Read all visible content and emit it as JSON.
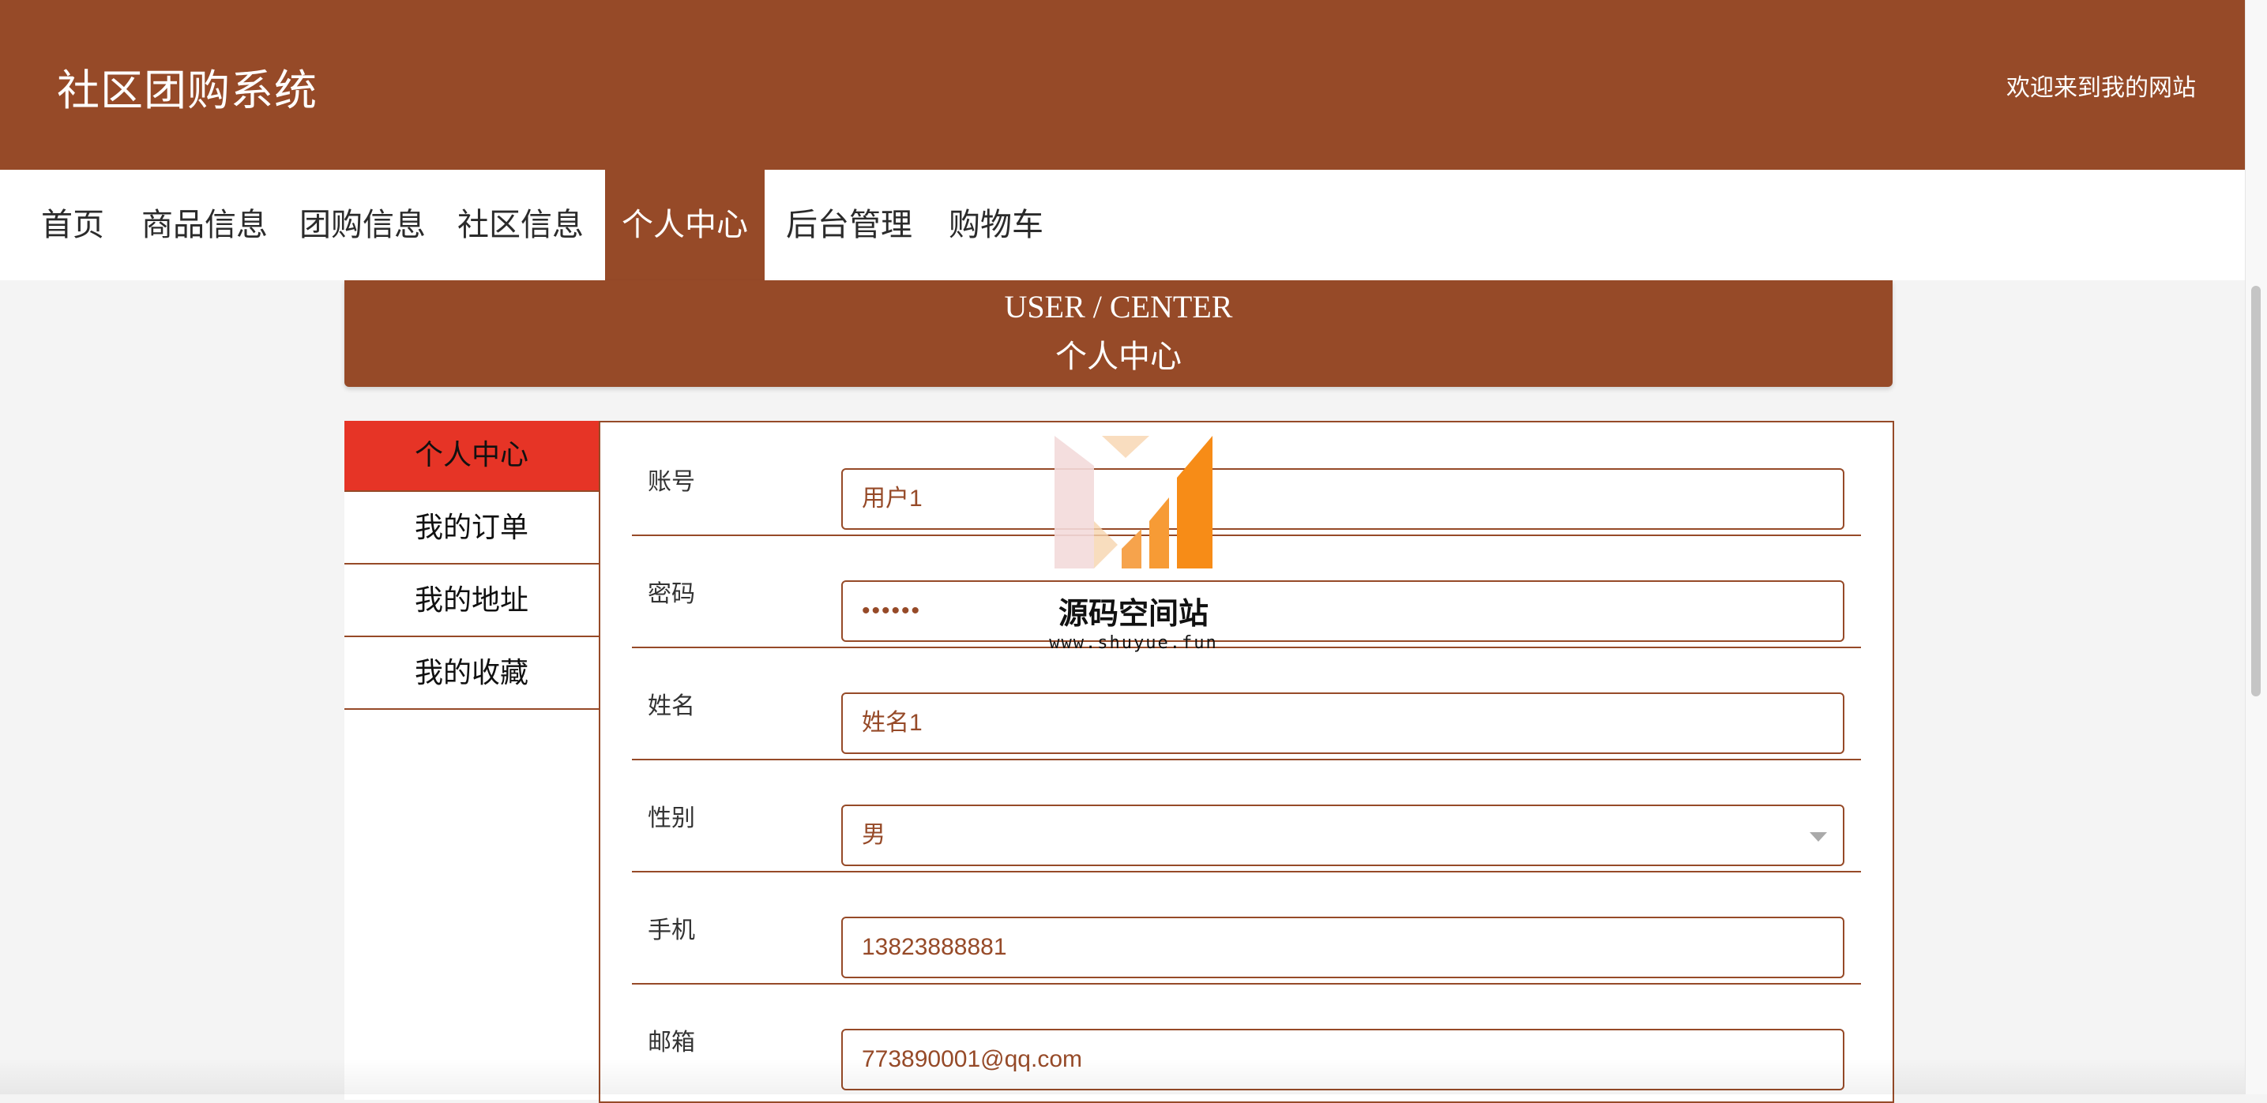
{
  "header": {
    "site_title": "社区团购系统",
    "welcome": "欢迎来到我的网站"
  },
  "nav": {
    "items": [
      {
        "label": "首页"
      },
      {
        "label": "商品信息"
      },
      {
        "label": "团购信息"
      },
      {
        "label": "社区信息"
      },
      {
        "label": "个人中心"
      },
      {
        "label": "后台管理"
      },
      {
        "label": "购物车"
      }
    ],
    "active": "个人中心"
  },
  "banner": {
    "en": "USER / CENTER",
    "cn": "个人中心"
  },
  "sidebar": {
    "items": [
      {
        "label": "个人中心"
      },
      {
        "label": "我的订单"
      },
      {
        "label": "我的地址"
      },
      {
        "label": "我的收藏"
      }
    ],
    "active": "个人中心"
  },
  "form": {
    "fields": [
      {
        "label": "账号",
        "value": "用户1"
      },
      {
        "label": "密码",
        "value": "••••••"
      },
      {
        "label": "姓名",
        "value": "姓名1"
      },
      {
        "label": "性别",
        "value": "男"
      },
      {
        "label": "手机",
        "value": "13823888881"
      },
      {
        "label": "邮箱",
        "value": "773890001@qq.com"
      }
    ]
  },
  "watermark": {
    "text": "源码空间站",
    "url": "www.shuyue.fun"
  },
  "colors": {
    "brand": "#964a28",
    "sidebar_active": "#e63426",
    "background": "#f4f4f4"
  }
}
